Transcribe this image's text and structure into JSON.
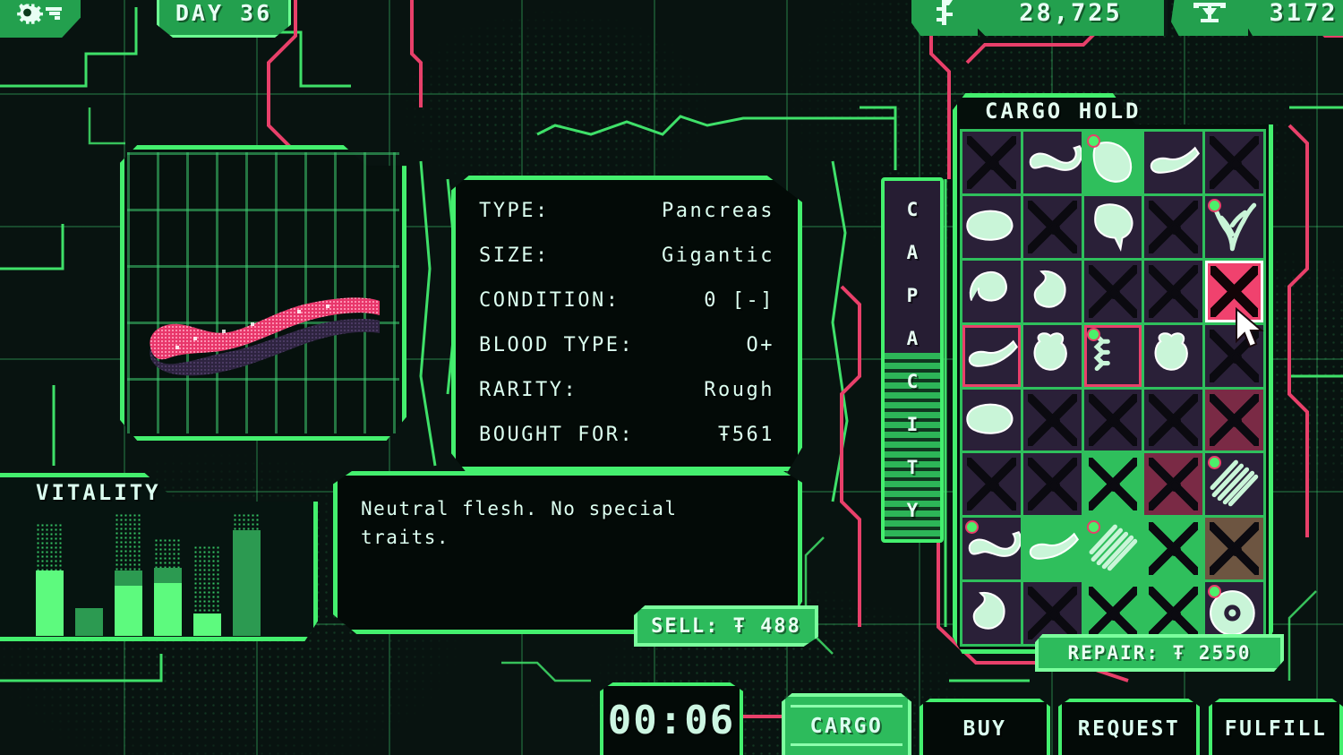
{
  "topbar": {
    "gear_icon": "gear-icon",
    "day_label": "DAY 36",
    "money_icon": "currency-icon",
    "money_value": "28,725",
    "reputation_icon": "scale-icon",
    "reputation_value": "3172"
  },
  "organ_preview": {
    "name": "organ-preview",
    "sprite": "pancreas-sprite",
    "color_primary": "#e8376b",
    "color_shadow": "#2e2440"
  },
  "info": {
    "rows": [
      {
        "key": "TYPE:",
        "value": "Pancreas"
      },
      {
        "key": "SIZE:",
        "value": "Gigantic"
      },
      {
        "key": "CONDITION:",
        "value": "0 [-]"
      },
      {
        "key": "BLOOD TYPE:",
        "value": "O+"
      },
      {
        "key": "RARITY:",
        "value": "Rough"
      },
      {
        "key": "BOUGHT FOR:",
        "value": "Ŧ561"
      }
    ]
  },
  "description": {
    "text": "Neutral flesh. No special traits."
  },
  "sell": {
    "label": "SELL: Ŧ 488"
  },
  "vitality": {
    "title": "VITALITY",
    "bars": [
      {
        "lit": 52,
        "mid": 0,
        "dim": 90
      },
      {
        "lit": 0,
        "mid": 22,
        "dim": 0
      },
      {
        "lit": 40,
        "mid": 52,
        "dim": 98
      },
      {
        "lit": 42,
        "mid": 54,
        "dim": 78
      },
      {
        "lit": 18,
        "mid": 0,
        "dim": 72
      },
      {
        "lit": 0,
        "mid": 84,
        "dim": 98
      }
    ]
  },
  "capacity": {
    "label_letters": [
      "C",
      "A",
      "P",
      "A",
      "C",
      "I",
      "T",
      "Y"
    ],
    "fill_percent": 52
  },
  "cargo": {
    "title": "CARGO HOLD",
    "columns": 5,
    "rows": 8,
    "slots": [
      {
        "state": "empty"
      },
      {
        "state": "filled",
        "organ": "intestine-sprite"
      },
      {
        "state": "filled",
        "organ": "lung-sprite",
        "selected": "green",
        "is_new": true
      },
      {
        "state": "filled",
        "organ": "pancreas-sprite"
      },
      {
        "state": "empty"
      },
      {
        "state": "filled",
        "organ": "liver-sprite"
      },
      {
        "state": "empty"
      },
      {
        "state": "filled",
        "organ": "brain-sprite"
      },
      {
        "state": "empty"
      },
      {
        "state": "filled",
        "organ": "nerve-sprite",
        "is_new": true
      },
      {
        "state": "filled",
        "organ": "stomach-sprite"
      },
      {
        "state": "filled",
        "organ": "kidney-sprite"
      },
      {
        "state": "empty"
      },
      {
        "state": "empty"
      },
      {
        "state": "empty",
        "hovered": true
      },
      {
        "state": "filled",
        "organ": "pancreas-sprite",
        "outline": "pink"
      },
      {
        "state": "filled",
        "organ": "heart-sprite"
      },
      {
        "state": "filled",
        "organ": "spine-sprite",
        "outline": "pink",
        "is_new": true
      },
      {
        "state": "filled",
        "organ": "heart-sprite"
      },
      {
        "state": "empty"
      },
      {
        "state": "filled",
        "organ": "liver-sprite"
      },
      {
        "state": "empty"
      },
      {
        "state": "empty"
      },
      {
        "state": "empty"
      },
      {
        "state": "empty",
        "tint": "pink"
      },
      {
        "state": "empty"
      },
      {
        "state": "empty"
      },
      {
        "state": "empty",
        "tint": "green"
      },
      {
        "state": "empty",
        "tint": "pink"
      },
      {
        "state": "filled",
        "organ": "ribs-sprite",
        "is_new": true
      },
      {
        "state": "filled",
        "organ": "intestine-sprite",
        "is_new": true
      },
      {
        "state": "filled",
        "organ": "pancreas-sprite",
        "tint": "green"
      },
      {
        "state": "filled",
        "organ": "ribs-sprite",
        "selected": "green",
        "is_new": true
      },
      {
        "state": "empty",
        "tint": "green"
      },
      {
        "state": "empty",
        "tint": "brown"
      },
      {
        "state": "filled",
        "organ": "kidney-sprite"
      },
      {
        "state": "empty"
      },
      {
        "state": "empty",
        "tint": "green"
      },
      {
        "state": "empty",
        "tint": "green"
      },
      {
        "state": "filled",
        "organ": "eye-sprite",
        "is_new": true
      }
    ]
  },
  "repair": {
    "label": "REPAIR: Ŧ 2550"
  },
  "timer": {
    "value": "00:06"
  },
  "tabs": [
    {
      "label": "CARGO",
      "active": true
    },
    {
      "label": "BUY",
      "active": false
    },
    {
      "label": "REQUEST",
      "active": false
    },
    {
      "label": "FULFILL",
      "active": false
    }
  ],
  "colors": {
    "bg": "#081310",
    "accent_green": "#44ef6e",
    "panel_green": "#23a04e",
    "text": "#dcfff0",
    "alert_pink": "#e8406a",
    "organ_pink": "#e8376b",
    "slot_dark": "#2a2038"
  }
}
